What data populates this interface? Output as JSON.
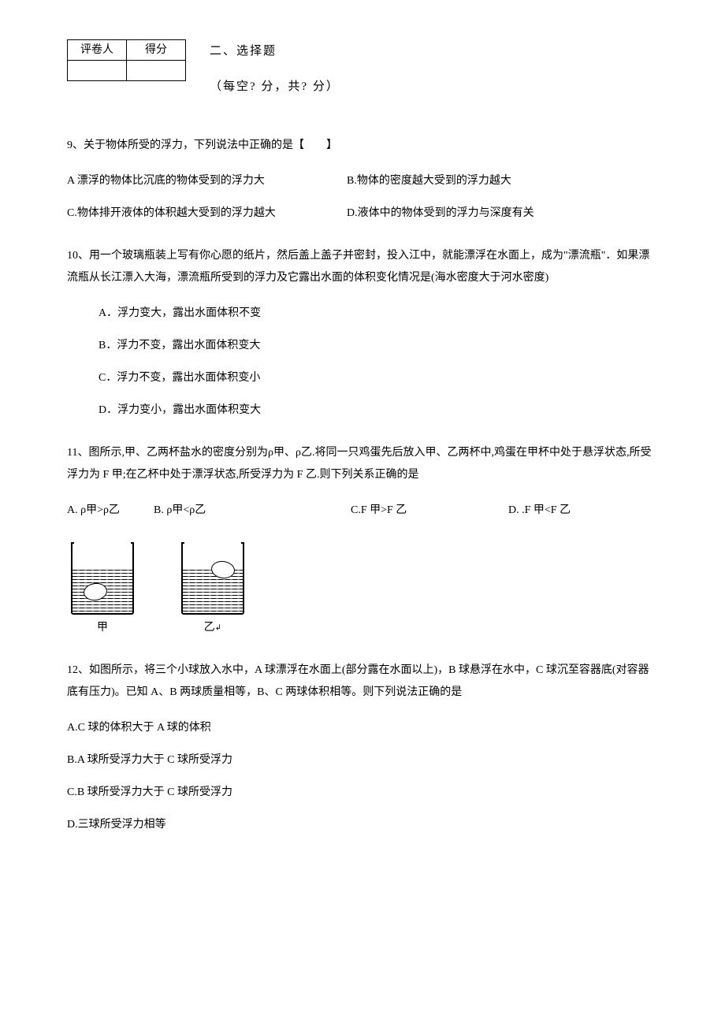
{
  "header": {
    "table": {
      "grader_label": "评卷人",
      "score_label": "得分"
    },
    "section_title": "二、选择题",
    "section_sub": "（每空?  分，共?  分）"
  },
  "q9": {
    "stem": "9、关于物体所受的浮力，下列说法中正确的是【　　】",
    "optA": "A 漂浮的物体比沉底的物体受到的浮力大",
    "optB": "B.物体的密度越大受到的浮力越大",
    "optC": "C.物体排开液体的体积越大受到的浮力越大",
    "optD": "D.液体中的物体受到的浮力与深度有关"
  },
  "q10": {
    "stem": "10、用一个玻璃瓶装上写有你心愿的纸片，然后盖上盖子并密封，投入江中，就能漂浮在水面上，成为\"漂流瓶\"．如果漂流瓶从长江漂入大海，漂流瓶所受到的浮力及它露出水面的体积变化情况是(海水密度大于河水密度)",
    "optA": "A．浮力变大，露出水面体积不变",
    "optB": "B．浮力不变，露出水面体积变大",
    "optC": "C．浮力不变，露出水面体积变小",
    "optD": "D．浮力变小，露出水面体积变大"
  },
  "q11": {
    "stem": "11、图所示,甲、乙两杯盐水的密度分别为ρ甲、ρ乙.将同一只鸡蛋先后放入甲、乙两杯中,鸡蛋在甲杯中处于悬浮状态,所受浮力为 F 甲;在乙杯中处于漂浮状态,所受浮力为 F 乙.则下列关系正确的是",
    "optA": "A. ρ甲>ρ乙",
    "optB": "B. ρ甲<ρ乙",
    "optC": "C.F 甲>F 乙",
    "optD": "D. .F 甲<F 乙",
    "label_a": "甲",
    "label_b": "乙"
  },
  "q12": {
    "stem": "12、如图所示，将三个小球放入水中，A 球漂浮在水面上(部分露在水面以上)，B 球悬浮在水中，C 球沉至容器底(对容器底有压力)。已知 A、B 两球质量相等，B、C 两球体积相等。则下列说法正确的是",
    "optA": "A.C 球的体积大于 A 球的体积",
    "optB": "B.A 球所受浮力大于 C 球所受浮力",
    "optC": "C.B 球所受浮力大于 C 球所受浮力",
    "optD": "D.三球所受浮力相等"
  }
}
